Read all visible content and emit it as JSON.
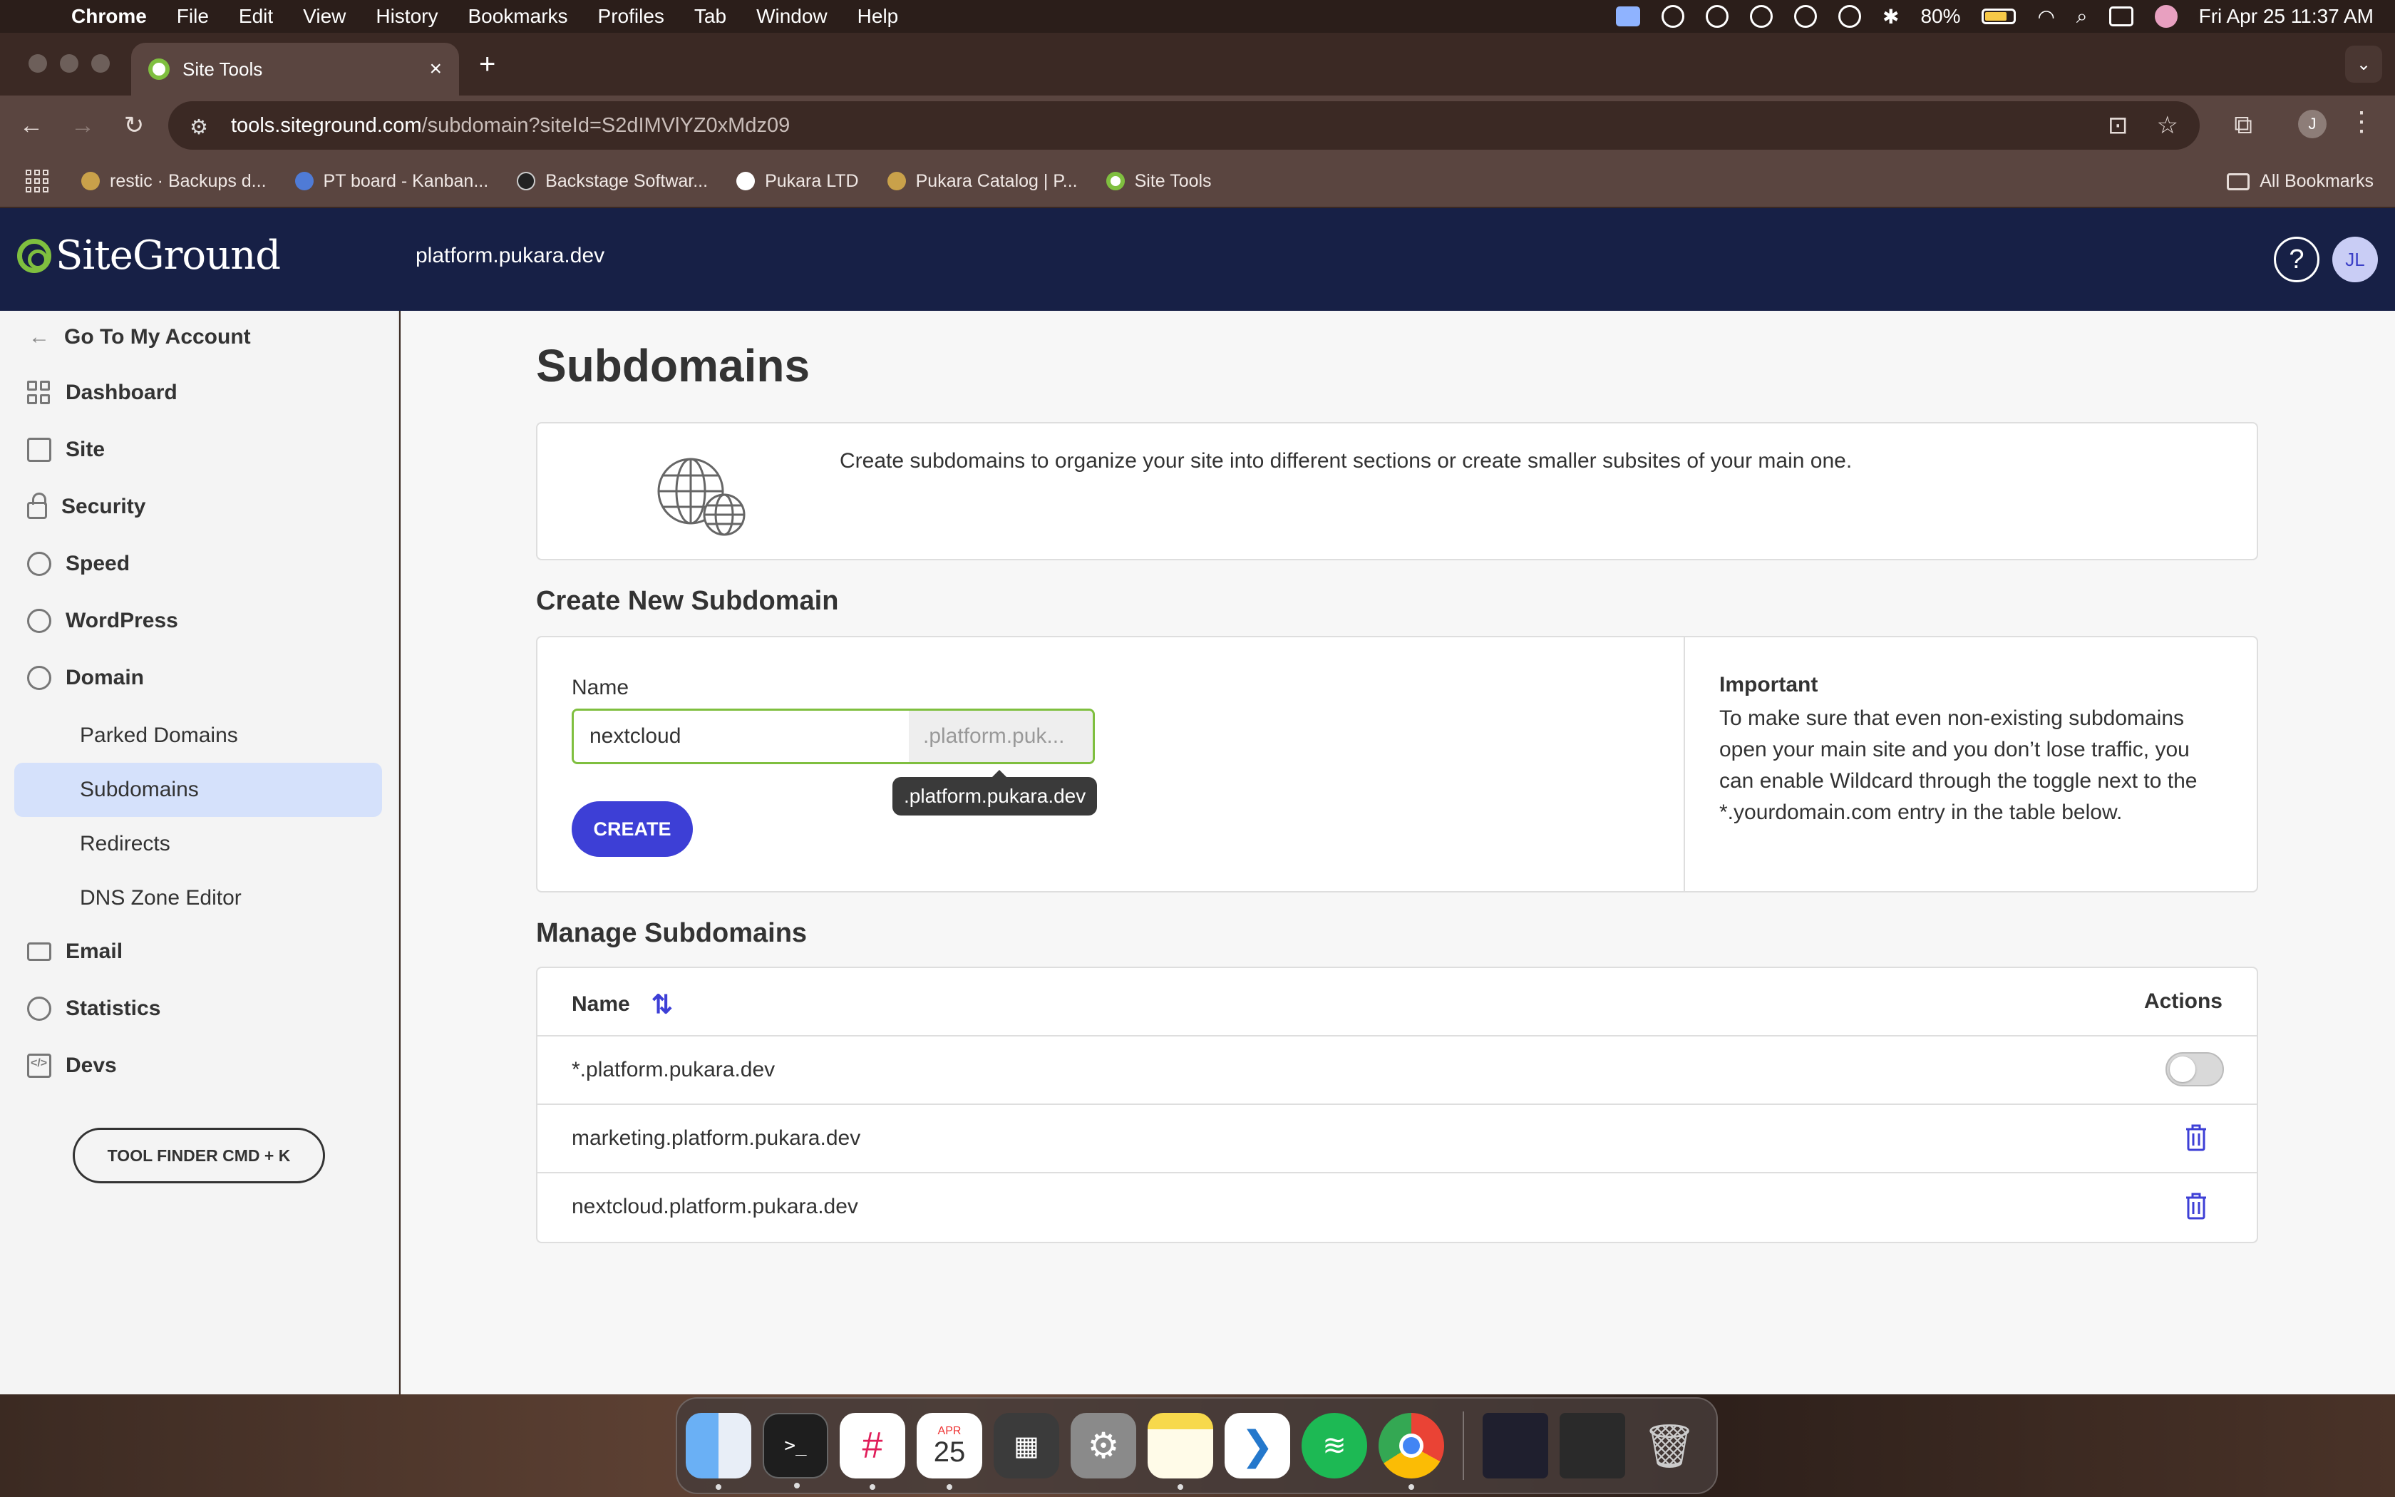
{
  "menubar": {
    "app_name": "Chrome",
    "menus": [
      "File",
      "Edit",
      "View",
      "History",
      "Bookmarks",
      "Profiles",
      "Tab",
      "Window",
      "Help"
    ],
    "battery": "80%",
    "datetime": "Fri Apr 25  11:37 AM"
  },
  "browser": {
    "tab_title": "Site Tools",
    "url_host": "tools.siteground.com",
    "url_path": "/subdomain?siteId=S2dIMVlYZ0xMdz09",
    "profile_initial": "J",
    "bookmarks": [
      "restic · Backups d...",
      "PT board - Kanban...",
      "Backstage Softwar...",
      "Pukara LTD",
      "Pukara Catalog | P...",
      "Site Tools"
    ],
    "all_bookmarks": "All Bookmarks"
  },
  "header": {
    "logo_text": "SiteGround",
    "domain": "platform.pukara.dev",
    "help": "?",
    "avatar": "JL"
  },
  "sidebar": {
    "back": "Go To My Account",
    "items": [
      "Dashboard",
      "Site",
      "Security",
      "Speed",
      "WordPress",
      "Domain"
    ],
    "sub_items": [
      "Parked Domains",
      "Subdomains",
      "Redirects",
      "DNS Zone Editor"
    ],
    "items_after": [
      "Email",
      "Statistics",
      "Devs"
    ],
    "tool_finder": "TOOL FINDER CMD + K"
  },
  "main": {
    "title": "Subdomains",
    "intro": "Create subdomains to organize your site into different sections or create smaller subsites of your main one.",
    "create_section": "Create New Subdomain",
    "name_label": "Name",
    "name_value": "nextcloud",
    "suffix": ".platform.puk...",
    "tooltip": ".platform.pukara.dev",
    "create_button": "CREATE",
    "important_title": "Important",
    "important_text": "To make sure that even non-existing subdomains open your main site and you don’t lose traffic, you can enable Wildcard through the toggle next to the *.yourdomain.com entry in the table below.",
    "manage_section": "Manage Subdomains",
    "table": {
      "col_name": "Name",
      "col_actions": "Actions",
      "rows": [
        "*.platform.pukara.dev",
        "marketing.platform.pukara.dev",
        "nextcloud.platform.pukara.dev"
      ]
    }
  },
  "dock": {
    "calendar_month": "APR",
    "calendar_day": "25"
  },
  "colors": {
    "header_bg": "#172046",
    "accent": "#3d3fd6",
    "active_nav": "#d5e1fb",
    "input_border": "#7fbf3f"
  }
}
